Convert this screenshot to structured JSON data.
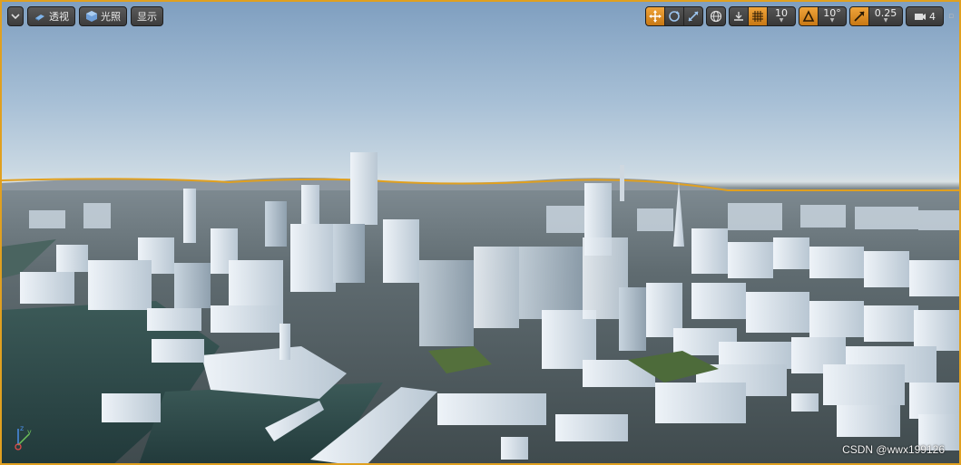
{
  "toolbar_left": {
    "menu_icon": "chevron-down-icon",
    "perspective_label": "透视",
    "lit_label": "光照",
    "show_label": "显示"
  },
  "toolbar_right": {
    "grid_snap_value": "10",
    "rotation_snap_value": "10°",
    "scale_snap_value": "0.25",
    "camera_speed_value": "4"
  },
  "watermark": "CSDN @wwx199126",
  "colors": {
    "accent": "#e0a020",
    "toggle_on": "#e08a20",
    "sky_top": "#7f9fc0",
    "horizon": "#d9e1e4",
    "water": "#2e4a48",
    "buildings": "#dfe7ee"
  }
}
